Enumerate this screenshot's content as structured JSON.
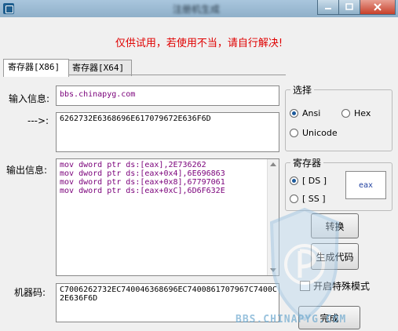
{
  "window": {
    "title": "注册机生成"
  },
  "notice": "仅供试用，若使用不当，请自行解决!",
  "tabs": [
    {
      "label": "寄存器[X86]"
    },
    {
      "label": "寄存器[X64]"
    }
  ],
  "input": {
    "label": "输入信息:",
    "value": "bbs.chinapyg.com"
  },
  "hex": {
    "label": "--->:",
    "value": "6262732E6368696E617079672E636F6D"
  },
  "output": {
    "label": "输出信息:",
    "lines": [
      "mov dword ptr ds:[eax],2E736262",
      "mov dword ptr ds:[eax+0x4],6E696863",
      "mov dword ptr ds:[eax+0x8],67797061",
      "mov dword ptr ds:[eax+0xC],6D6F632E"
    ]
  },
  "machine": {
    "label": "机器码:",
    "line1": "C7006262732EC740046368696EC7400861707967C7400C",
    "line2": "2E636F6D"
  },
  "select_group": {
    "title": "选择",
    "ansi": "Ansi",
    "hex": "Hex",
    "unicode": "Unicode",
    "selected": "Ansi"
  },
  "register_group": {
    "title": "寄存器",
    "ds": "[ DS ]",
    "ss": "[ SS ]",
    "selected": "[ DS ]",
    "value": "eax"
  },
  "buttons": {
    "convert": "转换",
    "generate": "生成代码",
    "done": "完成"
  },
  "checkbox": {
    "label": "开启特殊模式",
    "checked": false
  },
  "watermark": "BBS.CHINAPYG.COM"
}
